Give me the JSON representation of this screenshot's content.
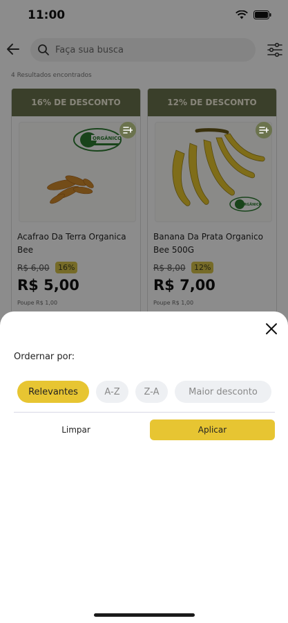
{
  "status_bar": {
    "time": "11:00"
  },
  "search": {
    "placeholder": "Faça sua busca"
  },
  "results": {
    "count_text": "4 Resultados encontrados"
  },
  "products": [
    {
      "discount_label": "16% DE DESCONTO",
      "name": "Acafrao Da Terra Organica Bee",
      "old_price": "R$ 6,00",
      "discount_pct": "16%",
      "price": "R$ 5,00",
      "savings": "Poupe R$ 1,00",
      "seal_text": "ORGÂNICO"
    },
    {
      "discount_label": "12% DE DESCONTO",
      "name": "Banana Da Prata Organico Bee 500G",
      "old_price": "R$ 8,00",
      "discount_pct": "12%",
      "price": "R$ 7,00",
      "savings": "Poupe R$ 1,00",
      "seal_text": "ORGÂNICO"
    }
  ],
  "sort_sheet": {
    "title": "Ordernar por:",
    "options": [
      "Relevantes",
      "A-Z",
      "Z-A",
      "Maior desconto"
    ],
    "selected_option": "Relevantes",
    "clear_label": "Limpar",
    "apply_label": "Aplicar"
  },
  "colors": {
    "accent_yellow": "#e7c532",
    "banner_olive": "#6b734d",
    "chip_inactive": "#eef0f3"
  },
  "icons": {
    "back": "arrow-left-icon",
    "search": "search-icon",
    "filter": "filter-sliders-icon",
    "add_to_list": "add-to-list-icon",
    "close": "close-icon"
  }
}
